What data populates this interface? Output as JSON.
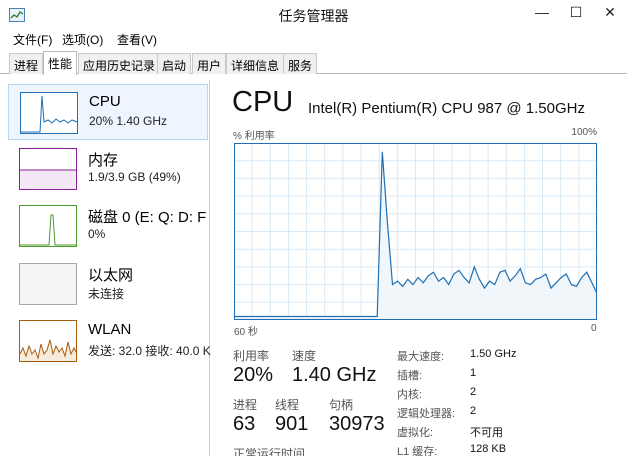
{
  "window": {
    "title": "任务管理器",
    "min_glyph": "—",
    "max_glyph": "☐",
    "close_glyph": "✕"
  },
  "menu": [
    "文件(F)",
    "选项(O)",
    "查看(V)"
  ],
  "tabs": [
    {
      "label": "进程",
      "active": false
    },
    {
      "label": "性能",
      "active": true
    },
    {
      "label": "应用历史记录",
      "active": false
    },
    {
      "label": "启动",
      "active": false
    },
    {
      "label": "用户",
      "active": false
    },
    {
      "label": "详细信息",
      "active": false
    },
    {
      "label": "服务",
      "active": false
    }
  ],
  "sidebar": {
    "items": [
      {
        "title": "CPU",
        "subtitle": "20% 1.40 GHz",
        "color": "#1e6fb4"
      },
      {
        "title": "内存",
        "subtitle": "1.9/3.9 GB (49%)",
        "color": "#8b1e9b"
      },
      {
        "title": "磁盘 0 (E: Q: D: F",
        "subtitle": "0%",
        "color": "#4c9a2a"
      },
      {
        "title": "以太网",
        "subtitle": "未连接",
        "color": "#a7a7a7"
      },
      {
        "title": "WLAN",
        "subtitle": "发送: 32.0 接收: 40.0 K",
        "color": "#a75c0e"
      }
    ]
  },
  "cpu": {
    "heading": "CPU",
    "model": "Intel(R) Pentium(R) CPU 987 @ 1.50GHz",
    "graph": {
      "label": "% 利用率",
      "max_label": "100%",
      "time_label": "60 秒",
      "zero_label": "0",
      "line_color": "#1e6fb4",
      "fill_color": "#f1f6fb",
      "grid_color": "#d9eaf6",
      "usage": [
        2,
        2,
        2,
        2,
        2,
        2,
        2,
        2,
        2,
        2,
        2,
        2,
        2,
        2,
        2,
        2,
        2,
        2,
        2,
        2,
        2,
        2,
        2,
        2,
        2,
        2,
        2,
        2,
        2,
        95,
        55,
        20,
        22,
        19,
        23,
        20,
        24,
        21,
        25,
        27,
        22,
        24,
        20,
        26,
        28,
        24,
        21,
        30,
        23,
        18,
        22,
        20,
        27,
        28,
        22,
        25,
        29,
        21,
        20,
        23,
        24,
        26,
        18,
        21,
        24,
        26,
        20,
        19,
        24,
        27,
        21,
        15
      ]
    },
    "stats": {
      "utilization_label": "利用率",
      "utilization_value": "20%",
      "speed_label": "速度",
      "speed_value": "1.40 GHz",
      "processes_label": "进程",
      "processes_value": "63",
      "threads_label": "线程",
      "threads_value": "901",
      "handles_label": "句柄",
      "handles_value": "30973",
      "uptime_label": "正常运行时间"
    },
    "specs": [
      {
        "label": "最大速度:",
        "value": "1.50 GHz"
      },
      {
        "label": "插槽:",
        "value": "1"
      },
      {
        "label": "内核:",
        "value": "2"
      },
      {
        "label": "逻辑处理器:",
        "value": "2"
      },
      {
        "label": "虚拟化:",
        "value": "不可用"
      },
      {
        "label": "L1 缓存:",
        "value": "128 KB"
      }
    ]
  }
}
